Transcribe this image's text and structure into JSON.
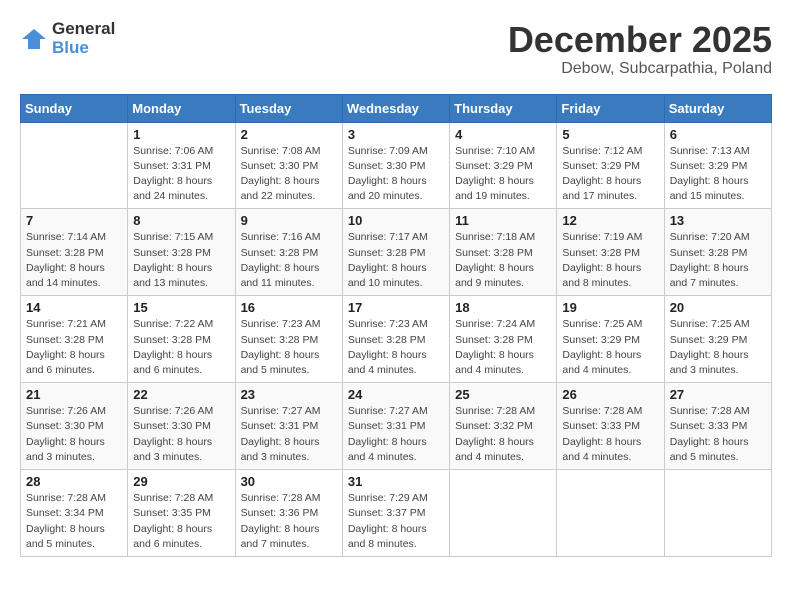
{
  "header": {
    "logo_general": "General",
    "logo_blue": "Blue",
    "month_title": "December 2025",
    "location": "Debow, Subcarpathia, Poland"
  },
  "days_of_week": [
    "Sunday",
    "Monday",
    "Tuesday",
    "Wednesday",
    "Thursday",
    "Friday",
    "Saturday"
  ],
  "weeks": [
    [
      {
        "day": "",
        "sunrise": "",
        "sunset": "",
        "daylight": ""
      },
      {
        "day": "1",
        "sunrise": "7:06 AM",
        "sunset": "3:31 PM",
        "daylight": "8 hours and 24 minutes."
      },
      {
        "day": "2",
        "sunrise": "7:08 AM",
        "sunset": "3:30 PM",
        "daylight": "8 hours and 22 minutes."
      },
      {
        "day": "3",
        "sunrise": "7:09 AM",
        "sunset": "3:30 PM",
        "daylight": "8 hours and 20 minutes."
      },
      {
        "day": "4",
        "sunrise": "7:10 AM",
        "sunset": "3:29 PM",
        "daylight": "8 hours and 19 minutes."
      },
      {
        "day": "5",
        "sunrise": "7:12 AM",
        "sunset": "3:29 PM",
        "daylight": "8 hours and 17 minutes."
      },
      {
        "day": "6",
        "sunrise": "7:13 AM",
        "sunset": "3:29 PM",
        "daylight": "8 hours and 15 minutes."
      }
    ],
    [
      {
        "day": "7",
        "sunrise": "7:14 AM",
        "sunset": "3:28 PM",
        "daylight": "8 hours and 14 minutes."
      },
      {
        "day": "8",
        "sunrise": "7:15 AM",
        "sunset": "3:28 PM",
        "daylight": "8 hours and 13 minutes."
      },
      {
        "day": "9",
        "sunrise": "7:16 AM",
        "sunset": "3:28 PM",
        "daylight": "8 hours and 11 minutes."
      },
      {
        "day": "10",
        "sunrise": "7:17 AM",
        "sunset": "3:28 PM",
        "daylight": "8 hours and 10 minutes."
      },
      {
        "day": "11",
        "sunrise": "7:18 AM",
        "sunset": "3:28 PM",
        "daylight": "8 hours and 9 minutes."
      },
      {
        "day": "12",
        "sunrise": "7:19 AM",
        "sunset": "3:28 PM",
        "daylight": "8 hours and 8 minutes."
      },
      {
        "day": "13",
        "sunrise": "7:20 AM",
        "sunset": "3:28 PM",
        "daylight": "8 hours and 7 minutes."
      }
    ],
    [
      {
        "day": "14",
        "sunrise": "7:21 AM",
        "sunset": "3:28 PM",
        "daylight": "8 hours and 6 minutes."
      },
      {
        "day": "15",
        "sunrise": "7:22 AM",
        "sunset": "3:28 PM",
        "daylight": "8 hours and 6 minutes."
      },
      {
        "day": "16",
        "sunrise": "7:23 AM",
        "sunset": "3:28 PM",
        "daylight": "8 hours and 5 minutes."
      },
      {
        "day": "17",
        "sunrise": "7:23 AM",
        "sunset": "3:28 PM",
        "daylight": "8 hours and 4 minutes."
      },
      {
        "day": "18",
        "sunrise": "7:24 AM",
        "sunset": "3:28 PM",
        "daylight": "8 hours and 4 minutes."
      },
      {
        "day": "19",
        "sunrise": "7:25 AM",
        "sunset": "3:29 PM",
        "daylight": "8 hours and 4 minutes."
      },
      {
        "day": "20",
        "sunrise": "7:25 AM",
        "sunset": "3:29 PM",
        "daylight": "8 hours and 3 minutes."
      }
    ],
    [
      {
        "day": "21",
        "sunrise": "7:26 AM",
        "sunset": "3:30 PM",
        "daylight": "8 hours and 3 minutes."
      },
      {
        "day": "22",
        "sunrise": "7:26 AM",
        "sunset": "3:30 PM",
        "daylight": "8 hours and 3 minutes."
      },
      {
        "day": "23",
        "sunrise": "7:27 AM",
        "sunset": "3:31 PM",
        "daylight": "8 hours and 3 minutes."
      },
      {
        "day": "24",
        "sunrise": "7:27 AM",
        "sunset": "3:31 PM",
        "daylight": "8 hours and 4 minutes."
      },
      {
        "day": "25",
        "sunrise": "7:28 AM",
        "sunset": "3:32 PM",
        "daylight": "8 hours and 4 minutes."
      },
      {
        "day": "26",
        "sunrise": "7:28 AM",
        "sunset": "3:33 PM",
        "daylight": "8 hours and 4 minutes."
      },
      {
        "day": "27",
        "sunrise": "7:28 AM",
        "sunset": "3:33 PM",
        "daylight": "8 hours and 5 minutes."
      }
    ],
    [
      {
        "day": "28",
        "sunrise": "7:28 AM",
        "sunset": "3:34 PM",
        "daylight": "8 hours and 5 minutes."
      },
      {
        "day": "29",
        "sunrise": "7:28 AM",
        "sunset": "3:35 PM",
        "daylight": "8 hours and 6 minutes."
      },
      {
        "day": "30",
        "sunrise": "7:28 AM",
        "sunset": "3:36 PM",
        "daylight": "8 hours and 7 minutes."
      },
      {
        "day": "31",
        "sunrise": "7:29 AM",
        "sunset": "3:37 PM",
        "daylight": "8 hours and 8 minutes."
      },
      {
        "day": "",
        "sunrise": "",
        "sunset": "",
        "daylight": ""
      },
      {
        "day": "",
        "sunrise": "",
        "sunset": "",
        "daylight": ""
      },
      {
        "day": "",
        "sunrise": "",
        "sunset": "",
        "daylight": ""
      }
    ]
  ],
  "labels": {
    "sunrise_prefix": "Sunrise: ",
    "sunset_prefix": "Sunset: ",
    "daylight_prefix": "Daylight: "
  }
}
